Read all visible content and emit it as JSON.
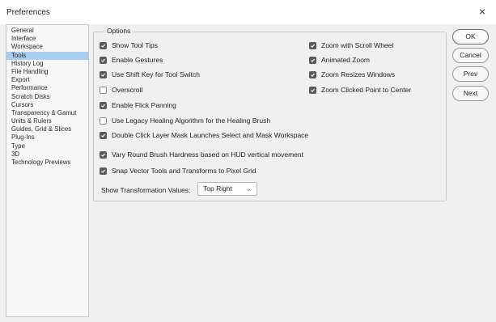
{
  "window": {
    "title": "Preferences",
    "close_glyph": "×"
  },
  "sidebar": {
    "items": [
      {
        "label": "General"
      },
      {
        "label": "Interface"
      },
      {
        "label": "Workspace"
      },
      {
        "label": "Tools",
        "selected": true
      },
      {
        "label": "History Log"
      },
      {
        "label": "File Handling"
      },
      {
        "label": "Export"
      },
      {
        "label": "Performance"
      },
      {
        "label": "Scratch Disks"
      },
      {
        "label": "Cursors"
      },
      {
        "label": "Transparency & Gamut"
      },
      {
        "label": "Units & Rulers"
      },
      {
        "label": "Guides, Grid & Slices"
      },
      {
        "label": "Plug-Ins"
      },
      {
        "label": "Type"
      },
      {
        "label": "3D"
      },
      {
        "label": "Technology Previews"
      }
    ]
  },
  "options": {
    "legend": "Options",
    "left": [
      {
        "label": "Show Tool Tips",
        "checked": true
      },
      {
        "label": "Enable Gestures",
        "checked": true
      },
      {
        "label": "Use Shift Key for Tool Switch",
        "checked": true
      },
      {
        "label": "Overscroll",
        "checked": false
      },
      {
        "label": "Enable Flick Panning",
        "checked": true
      },
      {
        "label": "Use Legacy Healing Algorithm for the Healing Brush",
        "checked": false
      },
      {
        "label": "Double Click Layer Mask Launches Select and Mask Workspace",
        "checked": true
      },
      {
        "label": "Vary Round Brush Hardness based on HUD vertical movement",
        "checked": true
      },
      {
        "label": "Snap Vector Tools and Transforms to Pixel Grid",
        "checked": true
      }
    ],
    "right": [
      {
        "label": "Zoom with Scroll Wheel",
        "checked": true
      },
      {
        "label": "Animated Zoom",
        "checked": true
      },
      {
        "label": "Zoom Resizes Windows",
        "checked": true
      },
      {
        "label": "Zoom Clicked Point to Center",
        "checked": true
      }
    ],
    "transformation": {
      "label": "Show Transformation Values:",
      "value": "Top Right"
    }
  },
  "buttons": {
    "ok": "OK",
    "cancel": "Cancel",
    "prev": "Prev",
    "next": "Next"
  },
  "colors": {
    "selection": "#a9cdf0",
    "checkbox_checked": "#5a5a5a"
  }
}
